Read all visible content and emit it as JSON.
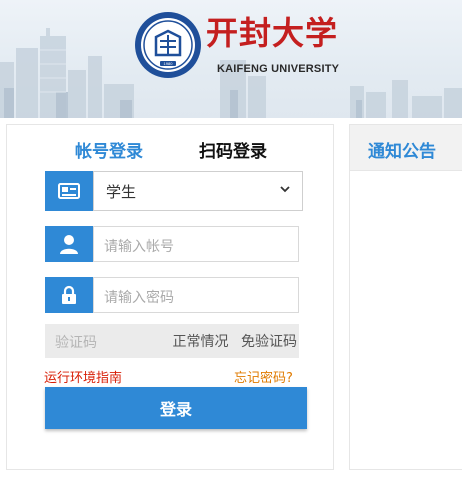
{
  "header": {
    "title": "开封大学",
    "subtitle": "KAIFENG UNIVERSITY",
    "seal_year": "1980"
  },
  "login": {
    "tabs": [
      {
        "label": "帐号登录",
        "active": true
      },
      {
        "label": "扫码登录",
        "active": false
      }
    ],
    "role_select": {
      "value": "学生"
    },
    "username": {
      "placeholder": "请输入帐号"
    },
    "password": {
      "placeholder": "请输入密码"
    },
    "captcha": {
      "placeholder": "验证码",
      "status_text": "正常情况",
      "exempt_text": "免验证码"
    },
    "env_guide_link": "运行环境指南",
    "forgot_link": "忘记密码?",
    "submit_label": "登录"
  },
  "notice": {
    "title": "通知公告"
  },
  "colors": {
    "accent": "#2f89d6",
    "brand_red": "#c41f1f",
    "link_red": "#d81e06",
    "link_orange": "#e07b00"
  },
  "icons": [
    "id-card-icon",
    "chevron-down-icon",
    "user-icon",
    "lock-icon"
  ]
}
